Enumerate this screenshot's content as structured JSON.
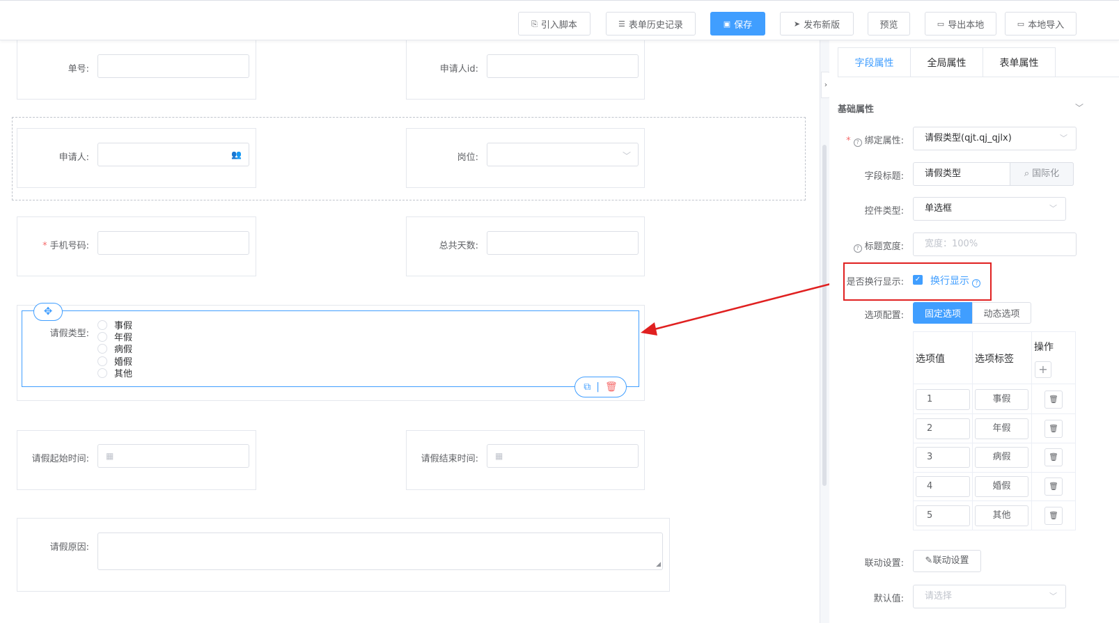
{
  "toolbar": {
    "import_script": "引入脚本",
    "history": "表单历史记录",
    "save": "保存",
    "publish": "发布新版",
    "preview": "预览",
    "export": "导出本地",
    "import_local": "本地导入"
  },
  "form": {
    "order_no": "单号:",
    "applicant_id": "申请人id:",
    "applicant": "申请人:",
    "position": "岗位:",
    "phone": "手机号码:",
    "total_days": "总共天数:",
    "leave_type": "请假类型:",
    "leave_options": [
      "事假",
      "年假",
      "病假",
      "婚假",
      "其他"
    ],
    "start_time": "请假起始时间:",
    "end_time": "请假结束时间:",
    "reason": "请假原因:"
  },
  "panel": {
    "tabs": [
      "字段属性",
      "全局属性",
      "表单属性"
    ],
    "section": "基础属性",
    "bind_label": "绑定属性:",
    "bind_value": "请假类型(qjt.qj_qjlx)",
    "title_label": "字段标题:",
    "title_value": "请假类型",
    "i18n": "国际化",
    "ctrl_label": "控件类型:",
    "ctrl_value": "单选框",
    "width_label": "标题宽度:",
    "width_placeholder": "宽度：100%",
    "wrap_label": "是否换行显示:",
    "wrap_check_label": "换行显示",
    "opt_label": "选项配置:",
    "opt_fixed": "固定选项",
    "opt_dynamic": "动态选项",
    "col_value": "选项值",
    "col_label": "选项标签",
    "col_ops": "操作",
    "rows": [
      {
        "value": "1",
        "label": "事假"
      },
      {
        "value": "2",
        "label": "年假"
      },
      {
        "value": "3",
        "label": "病假"
      },
      {
        "value": "4",
        "label": "婚假"
      },
      {
        "value": "5",
        "label": "其他"
      }
    ],
    "link_label": "联动设置:",
    "link_btn": "联动设置",
    "default_label": "默认值:",
    "default_placeholder": "请选择"
  },
  "colors": {
    "primary": "#409eff",
    "highlight": "#e02020"
  }
}
